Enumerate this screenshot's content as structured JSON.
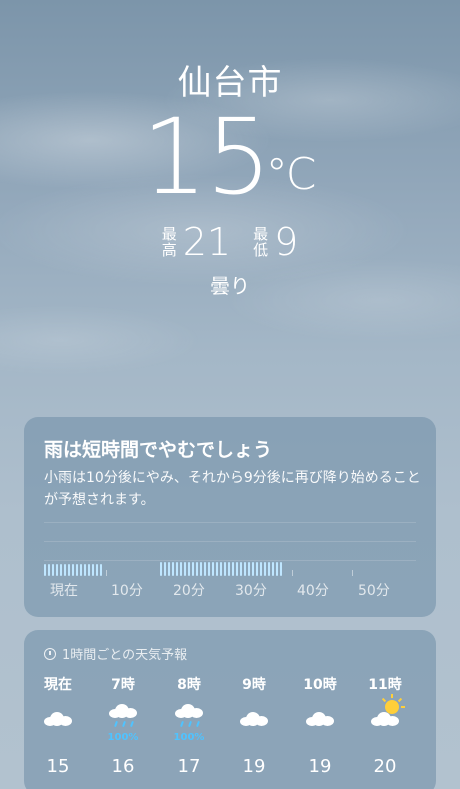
{
  "hero": {
    "city": "仙台市",
    "temperature": "15",
    "unit": "°C",
    "high_label_1": "最",
    "high_label_2": "高",
    "high": "21",
    "low_label_1": "最",
    "low_label_2": "低",
    "low": "9",
    "condition": "曇り"
  },
  "rain_card": {
    "title": "雨は短時間でやむでしょう",
    "description": "小雨は10分後にやみ、それから9分後に再び降り始めることが予想されます。",
    "axis": [
      "現在",
      "10分",
      "20分",
      "30分",
      "40分",
      "50分"
    ]
  },
  "hourly": {
    "header": "1時間ごとの天気予報",
    "items": [
      {
        "time": "現在",
        "icon": "cloud-icon",
        "prob": "",
        "temp": "15"
      },
      {
        "time": "7時",
        "icon": "cloud-rain-icon",
        "prob": "100%",
        "temp": "16"
      },
      {
        "time": "8時",
        "icon": "cloud-rain-icon",
        "prob": "100%",
        "temp": "17"
      },
      {
        "time": "9時",
        "icon": "cloud-icon",
        "prob": "",
        "temp": "19"
      },
      {
        "time": "10時",
        "icon": "cloud-icon",
        "prob": "",
        "temp": "19"
      },
      {
        "time": "11時",
        "icon": "partly-sunny-icon",
        "prob": "",
        "temp": "20"
      }
    ]
  },
  "colors": {
    "rain_bar": "#bfe6ff",
    "precip_prob": "#4fc3ff",
    "sun": "#ffcf3a"
  }
}
